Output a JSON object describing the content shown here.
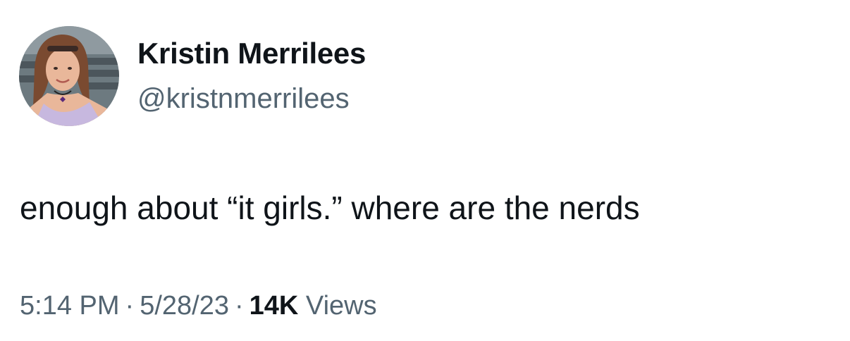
{
  "author": {
    "display_name": "Kristin Merrilees",
    "handle": "@kristnmerrilees",
    "avatar_icon": "profile-photo"
  },
  "tweet": {
    "text": "enough about “it girls.” where are the nerds"
  },
  "meta": {
    "time": "5:14 PM",
    "separator": "·",
    "date": "5/28/23",
    "views_count": "14K",
    "views_label": "Views"
  },
  "colors": {
    "primary_text": "#0f1419",
    "secondary_text": "#536471",
    "background": "#ffffff"
  }
}
